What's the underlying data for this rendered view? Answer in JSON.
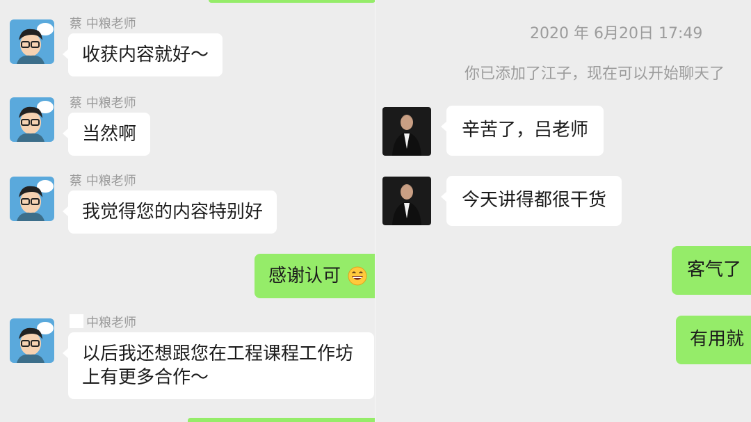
{
  "left": {
    "messages": [
      {
        "sender": "蔡 中粮老师",
        "text": "收获内容就好～"
      },
      {
        "sender": "蔡 中粮老师",
        "text": "当然啊"
      },
      {
        "sender": "蔡 中粮老师",
        "text": "我觉得您的内容特别好"
      },
      {
        "text": "感谢认可",
        "emoji": "grinning-smile-icon"
      },
      {
        "sender": "中粮老师",
        "text": "以后我还想跟您在工程课程工作坊上有更多合作～"
      }
    ]
  },
  "right": {
    "timestamp": "2020 年 6月20日 17:49",
    "system_notice": "你已添加了江子，现在可以开始聊天了",
    "messages": [
      {
        "text": "辛苦了，吕老师"
      },
      {
        "text": "今天讲得都很干货"
      },
      {
        "text": "客气了"
      },
      {
        "text": "有用就"
      }
    ]
  },
  "colors": {
    "chat_background": "#ededed",
    "incoming_bubble": "#ffffff",
    "outgoing_bubble": "#95ec69",
    "sender_name": "#9a9a9a"
  },
  "icons": {
    "left_avatar": "cartoon-teacher-avatar-icon",
    "right_avatar": "man-photo-avatar-icon"
  }
}
